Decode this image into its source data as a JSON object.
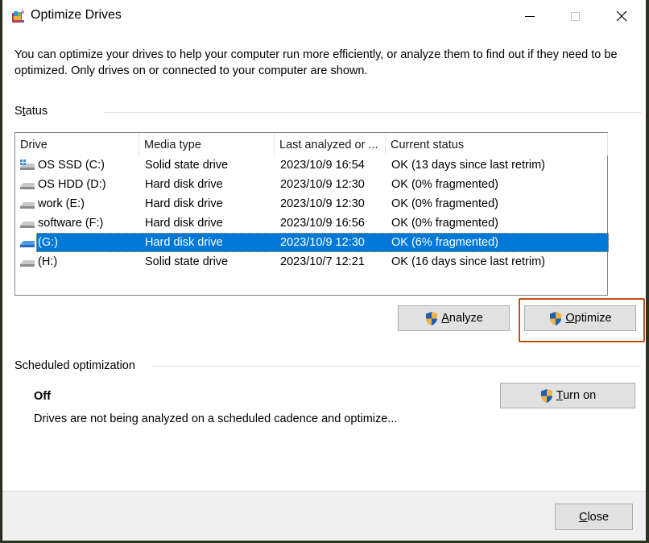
{
  "window": {
    "title": "Optimize Drives",
    "controls": {
      "minimize": "minimize-icon",
      "maximize": "maximize-icon",
      "close": "close-icon"
    }
  },
  "intro_text": "You can optimize your drives to help your computer run more efficiently, or analyze them to find out if they need to be optimized. Only drives on or connected to your computer are shown.",
  "status": {
    "label": "Status",
    "label_accesskey": "t",
    "columns": [
      "Drive",
      "Media type",
      "Last analyzed or ...",
      "Current status"
    ],
    "drives": [
      {
        "name": "OS SSD (C:)",
        "media_type": "Solid state drive",
        "last_analyzed": "2023/10/9 16:54",
        "status": "OK (13 days since last retrim)",
        "icon": "system-drive-icon",
        "selected": false
      },
      {
        "name": "OS HDD (D:)",
        "media_type": "Hard disk drive",
        "last_analyzed": "2023/10/9 12:30",
        "status": "OK (0% fragmented)",
        "icon": "drive-icon",
        "selected": false
      },
      {
        "name": "work (E:)",
        "media_type": "Hard disk drive",
        "last_analyzed": "2023/10/9 12:30",
        "status": "OK (0% fragmented)",
        "icon": "drive-icon",
        "selected": false
      },
      {
        "name": "software (F:)",
        "media_type": "Hard disk drive",
        "last_analyzed": "2023/10/9 16:56",
        "status": "OK (0% fragmented)",
        "icon": "drive-icon",
        "selected": false
      },
      {
        "name": "(G:)",
        "media_type": "Hard disk drive",
        "last_analyzed": "2023/10/9 12:30",
        "status": "OK (6% fragmented)",
        "icon": "drive-icon",
        "selected": true
      },
      {
        "name": "(H:)",
        "media_type": "Solid state drive",
        "last_analyzed": "2023/10/7 12:21",
        "status": "OK (16 days since last retrim)",
        "icon": "drive-icon",
        "selected": false
      }
    ]
  },
  "buttons": {
    "analyze": {
      "accesskey": "A",
      "rest": "nalyze"
    },
    "optimize": {
      "accesskey": "O",
      "rest": "ptimize"
    },
    "turn_on": {
      "accesskey": "T",
      "rest": "urn on"
    },
    "close": {
      "accesskey": "C",
      "rest": "lose"
    }
  },
  "scheduled": {
    "label": "Scheduled optimization",
    "state": "Off",
    "description": "Drives are not being analyzed on a scheduled cadence and optimize..."
  },
  "colors": {
    "selection": "#0078d7",
    "highlight_border": "#c0501a",
    "button_face": "#e1e1e1"
  }
}
